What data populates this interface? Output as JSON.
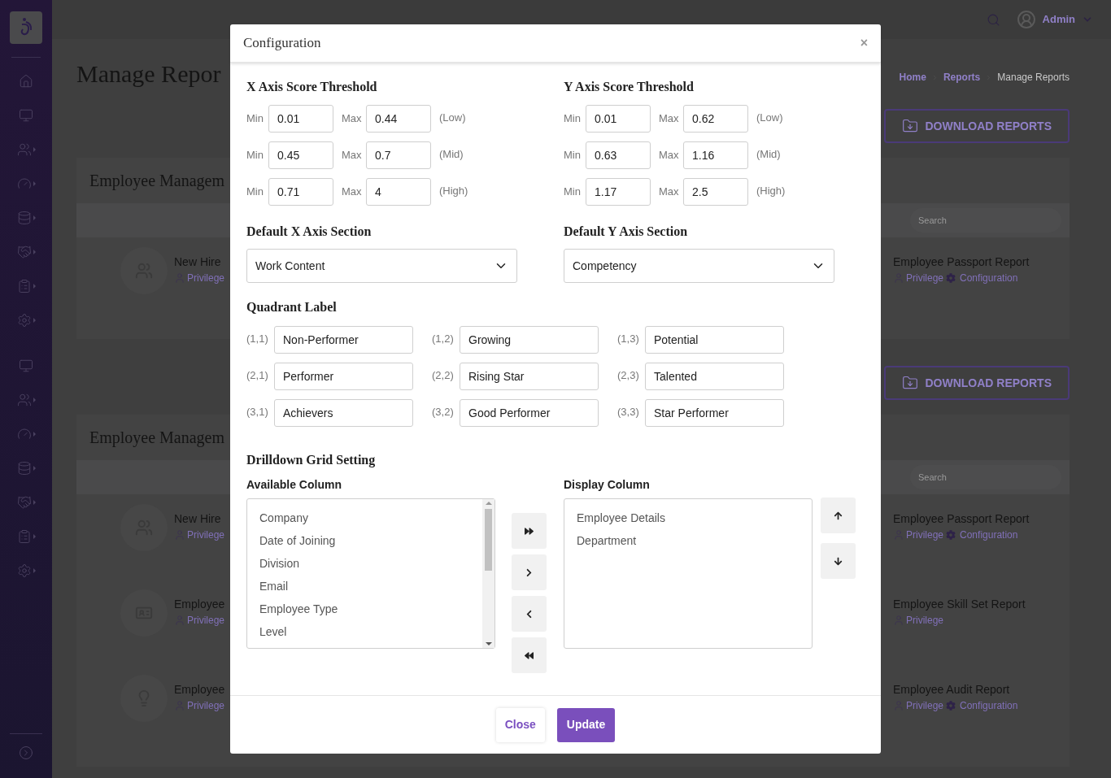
{
  "topbar": {
    "user": "Admin"
  },
  "page": {
    "title": "Manage Repor",
    "breadcrumbs": [
      "Home",
      "Reports",
      "Manage Reports"
    ]
  },
  "sections": [
    {
      "download_label": "DOWNLOAD REPORTS",
      "card_title": "Employee Managem",
      "search_placeholder": "Search",
      "rows": [
        {
          "left": {
            "title": "New Hire",
            "links": [
              {
                "kind": "privilege",
                "label": "Privilege"
              }
            ]
          },
          "right": {
            "title": "Employee Passport Report",
            "links": [
              {
                "kind": "privilege",
                "label": "Privilege"
              },
              {
                "kind": "configuration",
                "label": "Configuration"
              }
            ]
          }
        }
      ]
    },
    {
      "download_label": "DOWNLOAD REPORTS",
      "card_title": "Employee Managem",
      "search_placeholder": "Search",
      "rows": [
        {
          "left": {
            "title": "New Hire",
            "links": [
              {
                "kind": "privilege",
                "label": "Privilege"
              }
            ]
          },
          "right": {
            "title": "Employee Passport Report",
            "links": [
              {
                "kind": "privilege",
                "label": "Privilege"
              },
              {
                "kind": "configuration",
                "label": "Configuration"
              }
            ]
          }
        },
        {
          "left": {
            "title": "Employee",
            "links": [
              {
                "kind": "privilege",
                "label": "Privilege"
              }
            ]
          },
          "right": {
            "title": "Employee Skill Set Report",
            "links": [
              {
                "kind": "privilege",
                "label": "Privilege"
              }
            ]
          }
        },
        {
          "left": {
            "title": "Employee",
            "links": [
              {
                "kind": "privilege",
                "label": "Privilege"
              }
            ]
          },
          "right": {
            "title": "Employee Audit Report",
            "links": [
              {
                "kind": "privilege",
                "label": "Privilege"
              },
              {
                "kind": "configuration",
                "label": "Configuration"
              }
            ]
          }
        }
      ]
    }
  ],
  "modal": {
    "title": "Configuration",
    "close": "×",
    "thresholds": [
      {
        "title": "X Axis Score Threshold",
        "rows": [
          {
            "min_label": "Min",
            "min": "0.01",
            "max_label": "Max",
            "max": "0.44",
            "band": "(Low)"
          },
          {
            "min_label": "Min",
            "min": "0.45",
            "max_label": "Max",
            "max": "0.7",
            "band": "(Mid)"
          },
          {
            "min_label": "Min",
            "min": "0.71",
            "max_label": "Max",
            "max": "4",
            "band": "(High)"
          }
        ],
        "default_label": "Default X Axis Section",
        "default_value": "Work Content"
      },
      {
        "title": "Y Axis Score Threshold",
        "rows": [
          {
            "min_label": "Min",
            "min": "0.01",
            "max_label": "Max",
            "max": "0.62",
            "band": "(Low)"
          },
          {
            "min_label": "Min",
            "min": "0.63",
            "max_label": "Max",
            "max": "1.16",
            "band": "(Mid)"
          },
          {
            "min_label": "Min",
            "min": "1.17",
            "max_label": "Max",
            "max": "2.5",
            "band": "(High)"
          }
        ],
        "default_label": "Default Y Axis Section",
        "default_value": "Competency"
      }
    ],
    "quadrant": {
      "title": "Quadrant Label",
      "cells": [
        {
          "index": "(1,1)",
          "value": "Non-Performer"
        },
        {
          "index": "(1,2)",
          "value": "Growing"
        },
        {
          "index": "(1,3)",
          "value": "Potential"
        },
        {
          "index": "(2,1)",
          "value": "Performer"
        },
        {
          "index": "(2,2)",
          "value": "Rising Star"
        },
        {
          "index": "(2,3)",
          "value": "Talented"
        },
        {
          "index": "(3,1)",
          "value": "Achievers"
        },
        {
          "index": "(3,2)",
          "value": "Good Performer"
        },
        {
          "index": "(3,3)",
          "value": "Star Performer"
        }
      ]
    },
    "drilldown": {
      "title": "Drilldown Grid Setting",
      "available": {
        "label": "Available Column",
        "items": [
          "Company",
          "Date of Joining",
          "Division",
          "Email",
          "Employee Type",
          "Level"
        ]
      },
      "display": {
        "label": "Display Column",
        "items": [
          "Employee Details",
          "Department"
        ]
      }
    },
    "footer": {
      "close": "Close",
      "update": "Update"
    }
  }
}
